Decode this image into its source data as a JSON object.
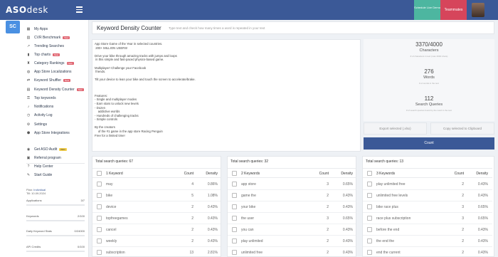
{
  "app": {
    "logo_main": "ASO",
    "logo_sub": "desk",
    "sc_badge": "SC",
    "schedule_demo": "Schedule Live Demo",
    "teammates": "Teammates"
  },
  "sidebar": {
    "items": [
      {
        "label": "My Apps",
        "icon": "grid-icon",
        "glyph": "▦",
        "tag": ""
      },
      {
        "label": "CVR Benchmark",
        "icon": "chart-icon",
        "glyph": "▥",
        "tag": "New"
      },
      {
        "label": "Trending Searches",
        "icon": "trending-icon",
        "glyph": "↗",
        "tag": ""
      },
      {
        "label": "Top charts",
        "icon": "bar-chart-icon",
        "glyph": "▮",
        "tag": "New"
      },
      {
        "label": "Category Rankings",
        "icon": "trophy-icon",
        "glyph": "♜",
        "tag": "New"
      },
      {
        "label": "App Store Localizations",
        "icon": "globe-icon",
        "glyph": "◍",
        "tag": ""
      },
      {
        "label": "Keyword Shuffler",
        "icon": "shuffle-icon",
        "glyph": "⇄",
        "tag": "New"
      },
      {
        "label": "Keyword Density Counter",
        "icon": "density-icon",
        "glyph": "▤",
        "tag": "New"
      },
      {
        "label": "Top keywords",
        "icon": "key-icon",
        "glyph": "⚿",
        "tag": ""
      },
      {
        "label": "Notifications",
        "icon": "bell-icon",
        "glyph": "♪",
        "tag": ""
      },
      {
        "label": "Activity Log",
        "icon": "clock-icon",
        "glyph": "◷",
        "tag": ""
      },
      {
        "label": "Settings",
        "icon": "gear-icon",
        "glyph": "⚙",
        "tag": ""
      },
      {
        "label": "App Store Integrations",
        "icon": "plug-icon",
        "glyph": "⬢",
        "tag": ""
      },
      {
        "label": "Get ASO Audit",
        "icon": "audit-icon",
        "glyph": "◉",
        "tag": "PRO"
      },
      {
        "label": "Referral program",
        "icon": "referral-icon",
        "glyph": "▣",
        "tag": ""
      },
      {
        "label": "Help Center",
        "icon": "help-icon",
        "glyph": "?",
        "tag": ""
      },
      {
        "label": "Start Guide",
        "icon": "guide-icon",
        "glyph": "✎",
        "tag": ""
      }
    ],
    "plan_label": "Plan:",
    "plan_name": "Individual",
    "plan_date": "Till: 10.09.2024",
    "stats": [
      {
        "label": "Applications",
        "value": "3/7"
      },
      {
        "label": "Keywords",
        "value": "2/100"
      },
      {
        "label": "Daily Keyword Stats",
        "value": "0/24000"
      },
      {
        "label": "API Credits",
        "value": "0/100"
      }
    ]
  },
  "header": {
    "title": "Keyword Density Counter",
    "subtitle": "Type text and check how many times a word is repeated in your text"
  },
  "textarea": {
    "content": "App Store Game of the Year in selected countries.\n 200+ MILLION USERS!\n\nDrive your bike through amazing tracks with jumps and loops\n in this simple and fast-paced physics-based game.\n\nMultiplayer! Challenge your Facebook\n friends.\n\nTilt your device to lean your bike and touch the screen to accelerate/brake.\n\n\n\nFeatures:\n- Single and multiplayer modes\n- Earn stars to unlock new levels\n- Dozen\n    addictive worlds\n- Hundreds of challenging tracks\n- Simple controls\n\nBy the creators\n    of the #1 game in the app store Racing Penguin\nFree for a limited time!"
  },
  "stats": {
    "characters": {
      "value": "3370/4000",
      "label": "Characters",
      "note": "# of characters in text (max 4000 chars)"
    },
    "words": {
      "value": "276",
      "label": "Words",
      "note": "# of words in the text"
    },
    "queries": {
      "value": "112",
      "label": "Search Queries",
      "note": "# of search queries found by the word in the text"
    }
  },
  "actions": {
    "export": "Export selected (.xlsx)",
    "copy": "Copy selected to Clipboard",
    "count": "Count"
  },
  "tables": [
    {
      "total": "Total search queries: 67",
      "col_kw": "1 Keyword",
      "col_count": "Count",
      "col_density": "Density",
      "rows": [
        {
          "kw": "may",
          "count": "4",
          "density": "0.86%"
        },
        {
          "kw": "bike",
          "count": "5",
          "density": "1.08%"
        },
        {
          "kw": "device",
          "count": "2",
          "density": "0.43%"
        },
        {
          "kw": "topfreegames",
          "count": "2",
          "density": "0.43%"
        },
        {
          "kw": "cancel",
          "count": "2",
          "density": "0.43%"
        },
        {
          "kw": "weekly",
          "count": "2",
          "density": "0.43%"
        },
        {
          "kw": "subscription",
          "count": "13",
          "density": "2.81%"
        }
      ]
    },
    {
      "total": "Total search queries: 32",
      "col_kw": "2 Keywords",
      "col_count": "Count",
      "col_density": "Density",
      "rows": [
        {
          "kw": "app store",
          "count": "3",
          "density": "0.65%"
        },
        {
          "kw": "game the",
          "count": "2",
          "density": "0.43%"
        },
        {
          "kw": "your bike",
          "count": "2",
          "density": "0.43%"
        },
        {
          "kw": "the user",
          "count": "3",
          "density": "0.65%"
        },
        {
          "kw": "you can",
          "count": "2",
          "density": "0.43%"
        },
        {
          "kw": "play unlimited",
          "count": "2",
          "density": "0.43%"
        },
        {
          "kw": "unlimited free",
          "count": "2",
          "density": "0.43%"
        }
      ]
    },
    {
      "total": "Total search queries: 13",
      "col_kw": "3 Keywords",
      "col_count": "Count",
      "col_density": "Density",
      "rows": [
        {
          "kw": "play unlimited free",
          "count": "2",
          "density": "0.43%"
        },
        {
          "kw": "unlimited free levels",
          "count": "2",
          "density": "0.43%"
        },
        {
          "kw": "bike race plus",
          "count": "3",
          "density": "0.65%"
        },
        {
          "kw": "race plus subscription",
          "count": "3",
          "density": "0.65%"
        },
        {
          "kw": "before the end",
          "count": "2",
          "density": "0.43%"
        },
        {
          "kw": "the end the",
          "count": "2",
          "density": "0.43%"
        },
        {
          "kw": "end the current",
          "count": "2",
          "density": "0.43%"
        }
      ]
    }
  ]
}
